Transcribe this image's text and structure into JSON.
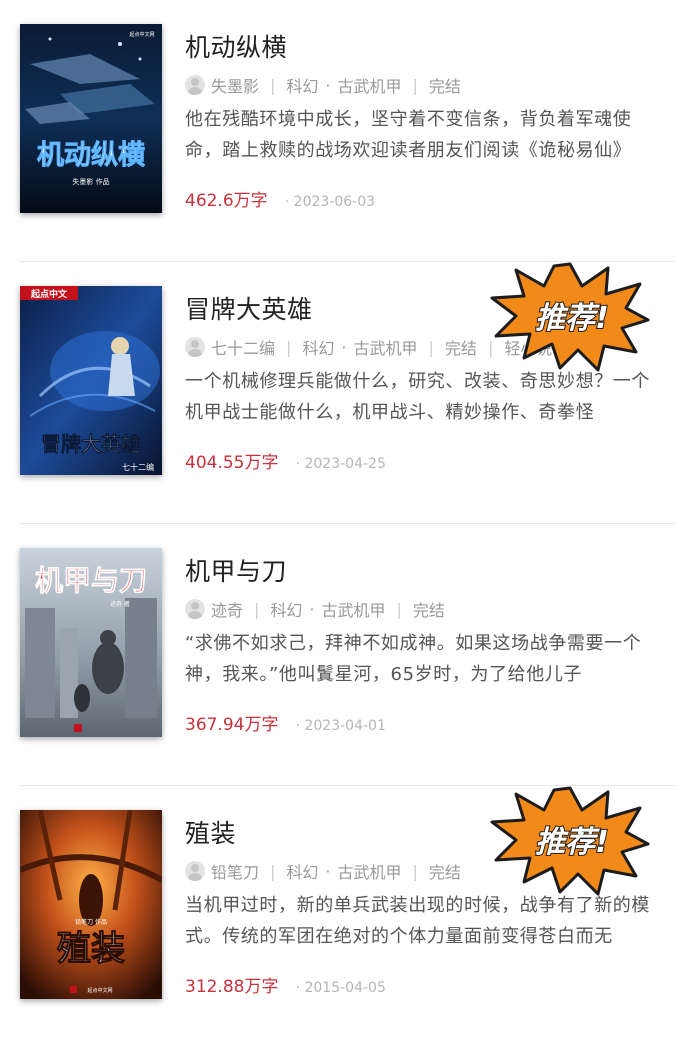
{
  "books": [
    {
      "title": "机动纵横",
      "author": "失墨影",
      "category": "科幻",
      "subcategory": "古武机甲",
      "status": "完结",
      "extra_tag": "",
      "description": "他在残酷环境中成长，坚守着不变信条，背负着军魂使命，踏上救赎的战场欢迎读者朋友们阅读《诡秘易仙》",
      "word_count": "462.6万字",
      "date": "2023-06-03",
      "recommended": false,
      "cover": {
        "title_text": "机动纵横",
        "author_text": "失墨影 作品",
        "publisher_text": "起点中文网"
      }
    },
    {
      "title": "冒牌大英雄",
      "author": "七十二编",
      "category": "科幻",
      "subcategory": "古武机甲",
      "status": "完结",
      "extra_tag": "轻小说",
      "description": "一个机械修理兵能做什么，研究、改装、奇思妙想？一个机甲战士能做什么，机甲战斗、精妙操作、奇拳怪",
      "word_count": "404.55万字",
      "date": "2023-04-25",
      "recommended": true,
      "cover": {
        "title_text": "冒牌大英雄",
        "author_text": "七十二编",
        "publisher_text": "起点中文"
      }
    },
    {
      "title": "机甲与刀",
      "author": "迹奇",
      "category": "科幻",
      "subcategory": "古武机甲",
      "status": "完结",
      "extra_tag": "",
      "description": "“求佛不如求己，拜神不如成神。如果这场战争需要一个神，我来。”他叫鬒星河，65岁时，为了给他儿子",
      "word_count": "367.94万字",
      "date": "2023-04-01",
      "recommended": false,
      "cover": {
        "title_text": "机甲与刀",
        "author_text": "迹奇 著",
        "publisher_text": ""
      }
    },
    {
      "title": "殖装",
      "author": "铅笔刀",
      "category": "科幻",
      "subcategory": "古武机甲",
      "status": "完结",
      "extra_tag": "",
      "description": "当机甲过时，新的单兵武装出现的时候，战争有了新的模式。传统的军团在绝对的个体力量面前变得苍白而无",
      "word_count": "312.88万字",
      "date": "2015-04-05",
      "recommended": true,
      "cover": {
        "title_text": "殖装",
        "author_text": "铅笔刀 作品",
        "publisher_text": "起点中文网"
      }
    }
  ],
  "badge_text": "推荐!",
  "colors": {
    "word_count": "#c8323c",
    "badge_fill": "#f28a1a",
    "badge_text": "#ffffff"
  },
  "icons": {
    "avatar": "default-avatar-icon"
  }
}
